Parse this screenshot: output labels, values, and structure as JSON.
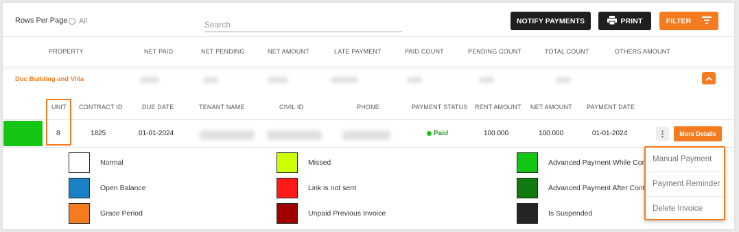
{
  "toolbar": {
    "rows_per_page_label": "Rows Per Page",
    "rows_option_all": "All",
    "search_placeholder": "Search",
    "notify_payments": "NOTIFY PAYMENTS",
    "print": "PRINT",
    "filter": "FILTER"
  },
  "summary_headers": [
    "PROPERTY",
    "NET PAID",
    "NET PENDING",
    "NET AMOUNT",
    "LATE PAYMENT",
    "PAID COUNT",
    "PENDING COUNT",
    "TOTAL COUNT",
    "OTHERS AMOUNT"
  ],
  "group": {
    "title": "Doc Building and Villa"
  },
  "unit_headers": [
    "UNIT",
    "CONTRACT ID",
    "DUE DATE",
    "TENANT NAME",
    "CIVIL ID",
    "PHONE",
    "PAYMENT STATUS",
    "RENT AMOUNT",
    "NET AMOUNT",
    "PAYMENT DATE"
  ],
  "row": {
    "unit": "8",
    "contract_id": "1825",
    "due_date": "01-01-2024",
    "payment_status": "Paid",
    "rent_amount": "100.000",
    "net_amount": "100.000",
    "payment_date": "01-01-2024",
    "more_details": "More Details",
    "kebab": "⋮"
  },
  "legend": [
    {
      "label": "Normal",
      "color": "#ffffff"
    },
    {
      "label": "Open Balance",
      "color": "#1a82c4"
    },
    {
      "label": "Grace Period",
      "color": "#f47b20"
    },
    {
      "label": "Missed",
      "color": "#ccff00"
    },
    {
      "label": "Link is not sent",
      "color": "#ff1a1a"
    },
    {
      "label": "Unpaid Previous Invoice",
      "color": "#a00000"
    },
    {
      "label": "Advanced Payment While Con",
      "color": "#14c614"
    },
    {
      "label": "Advanced Payment After Cont",
      "color": "#137a0f"
    },
    {
      "label": "Is Suspended",
      "color": "#252525"
    }
  ],
  "menu": [
    "Manual Payment",
    "Payment Reminder",
    "Delete Invoice"
  ],
  "colors": {
    "accent": "#f47b20",
    "dark_button": "#1f1f1f",
    "paid_green": "#14c614"
  }
}
